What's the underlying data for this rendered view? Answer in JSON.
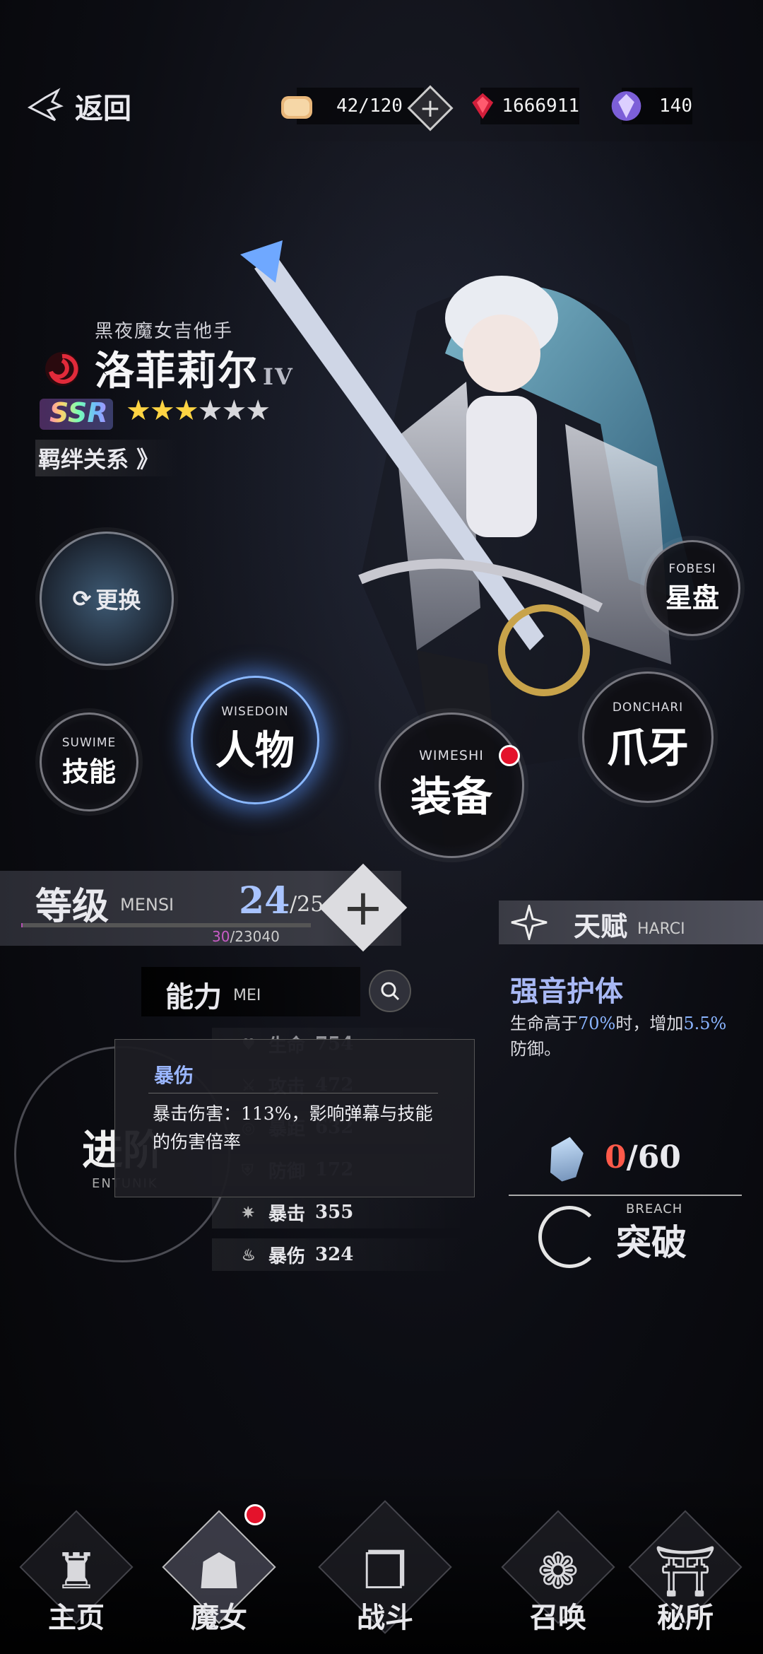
{
  "topbar": {
    "back_label": "返回",
    "stamina": "42/120",
    "gems": "1666911",
    "crystals": "140"
  },
  "character": {
    "subtitle": "黑夜魔女吉他手",
    "name": "洛菲莉尔",
    "rank_roman": "IV",
    "rarity": "SSR",
    "stars_filled": 3,
    "stars_total": 6,
    "bond_label": "羁绊关系 》"
  },
  "buttons": {
    "change": "更换",
    "starchart_en": "FOBESI",
    "starchart": "星盘",
    "skill_en": "SUWIME",
    "skill": "技能",
    "person_en": "WISEDOIN",
    "person": "人物",
    "equip_en": "WIMESHI",
    "equip": "装备",
    "claw_en": "DONCHARI",
    "claw": "爪牙"
  },
  "level": {
    "label": "等级",
    "label_en": "MENSI",
    "current": "24",
    "max": "/25",
    "exp_current": "30",
    "exp_max": "/23040",
    "exp_fraction": 0.0013
  },
  "talent": {
    "label": "天赋",
    "label_en": "HARCI",
    "name": "强音护体",
    "desc_pre": "生命高于",
    "desc_hl1": "70%",
    "desc_mid": "时，增加",
    "desc_hl2": "5.5%",
    "desc_post": "防御。"
  },
  "ability": {
    "label": "能力",
    "label_en": "MEI",
    "stats": [
      {
        "name": "生命",
        "value": "754"
      },
      {
        "name": "攻击",
        "value": "472"
      },
      {
        "name": "暴距",
        "value": "632"
      },
      {
        "name": "防御",
        "value": "172"
      },
      {
        "name": "暴击",
        "value": "355"
      },
      {
        "name": "暴伤",
        "value": "324"
      }
    ]
  },
  "tooltip": {
    "title": "暴伤",
    "body": "暴击伤害：113%，影响弹幕与技能的伤害倍率"
  },
  "advance": {
    "label": "进阶",
    "label_en": "ENTUNIK"
  },
  "breach": {
    "current": "0",
    "max": "/60",
    "label_en": "BREACH",
    "label": "突破"
  },
  "nav": [
    {
      "label": "主页"
    },
    {
      "label": "魔女"
    },
    {
      "label": "战斗"
    },
    {
      "label": "召唤"
    },
    {
      "label": "秘所"
    }
  ],
  "colors": {
    "accent_blue": "#8ab4ff",
    "red_dot": "#e4122b",
    "exp_purple": "#c85cc6"
  }
}
